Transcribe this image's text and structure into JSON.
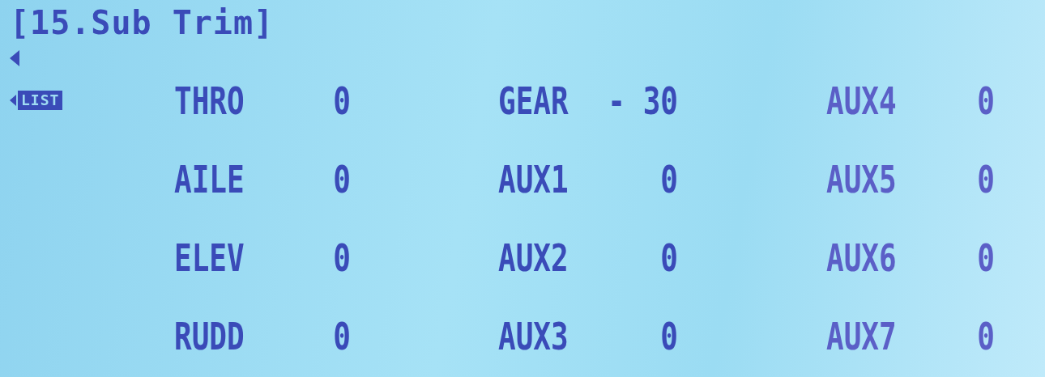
{
  "title": "[15.Sub Trim]",
  "list_button": {
    "label": "LIST"
  },
  "columns": [
    [
      {
        "channel": "THRO",
        "value": "0"
      },
      {
        "channel": "AILE",
        "value": "0"
      },
      {
        "channel": "ELEV",
        "value": "0"
      },
      {
        "channel": "RUDD",
        "value": "0"
      }
    ],
    [
      {
        "channel": "GEAR",
        "value": "- 30"
      },
      {
        "channel": "AUX1",
        "value": "0"
      },
      {
        "channel": "AUX2",
        "value": "0"
      },
      {
        "channel": "AUX3",
        "value": "0"
      }
    ],
    [
      {
        "channel": "AUX4",
        "value": "0"
      },
      {
        "channel": "AUX5",
        "value": "0"
      },
      {
        "channel": "AUX6",
        "value": "0"
      },
      {
        "channel": "AUX7",
        "value": "0"
      }
    ]
  ]
}
